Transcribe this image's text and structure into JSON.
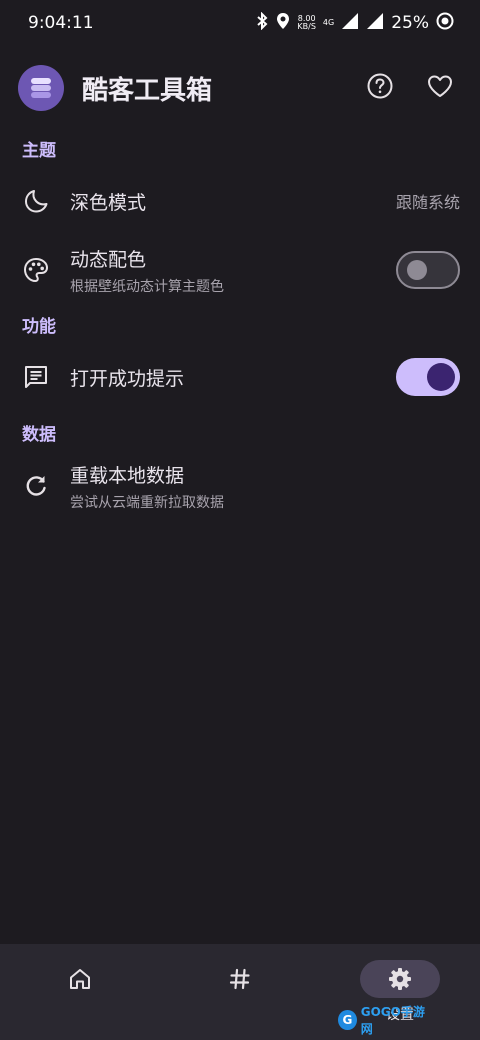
{
  "status_bar": {
    "time": "9:04:11",
    "speed_value": "8.00",
    "speed_unit": "KB/S",
    "network": "4G",
    "battery": "25%"
  },
  "app_bar": {
    "title": "酷客工具箱",
    "icons": [
      "help-icon",
      "heart-icon"
    ]
  },
  "sections": {
    "theme": {
      "title": "主题",
      "dark_mode": {
        "title": "深色模式",
        "value": "跟随系统",
        "icon": "moon-icon"
      },
      "dynamic_color": {
        "title": "动态配色",
        "subtitle": "根据壁纸动态计算主题色",
        "icon": "palette-icon",
        "enabled": false
      }
    },
    "features": {
      "title": "功能",
      "open_success_tip": {
        "title": "打开成功提示",
        "icon": "message-icon",
        "enabled": true
      }
    },
    "data": {
      "title": "数据",
      "reload": {
        "title": "重载本地数据",
        "subtitle": "尝试从云端重新拉取数据",
        "icon": "refresh-icon"
      }
    }
  },
  "bottom_nav": {
    "items": [
      {
        "icon": "home-icon",
        "label": ""
      },
      {
        "icon": "hashtag-icon",
        "label": ""
      },
      {
        "icon": "gear-icon",
        "label": "设置",
        "active": true
      }
    ]
  },
  "watermark": {
    "text": "GOGO手游网"
  },
  "colors": {
    "background": "#1d1b20",
    "accent": "#cdbdfc",
    "switch_knob_on": "#3b2470",
    "nav_bar": "#2a2830"
  }
}
